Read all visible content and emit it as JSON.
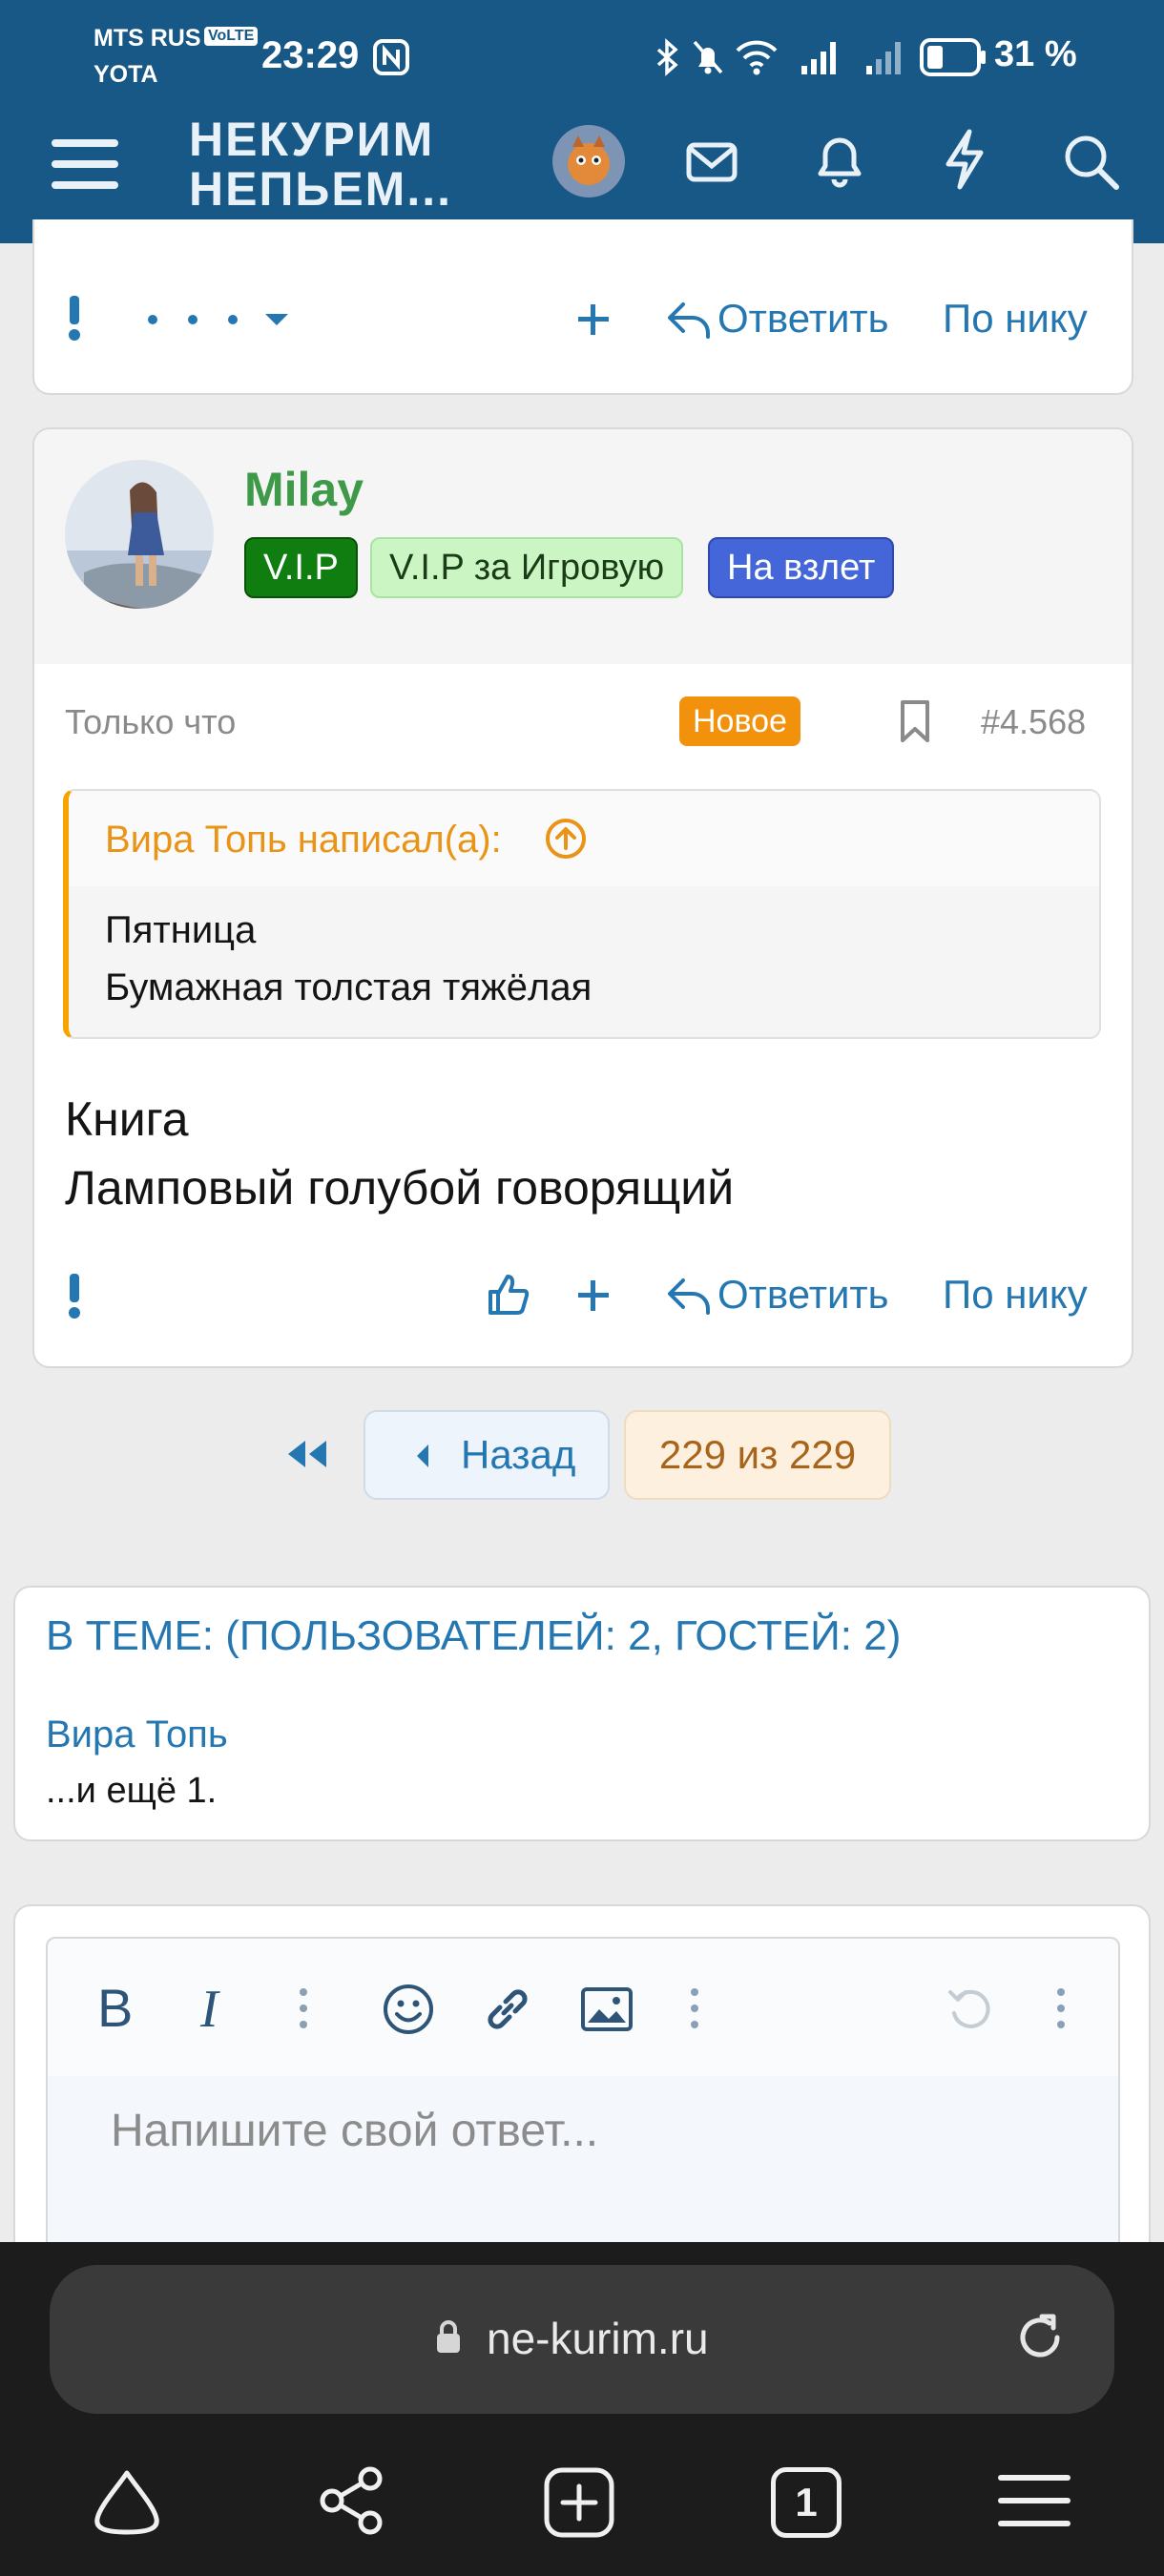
{
  "status_bar": {
    "carrier_1": "MTS RUS",
    "volte": "VoLTE",
    "carrier_2": "YOTA",
    "time": "23:29",
    "battery": "31 %"
  },
  "site_header": {
    "logo_line_1": "НЕКУРИМ",
    "logo_line_2": "НЕПЬЕМ..."
  },
  "prev_post_actions": {
    "reply": "Ответить",
    "by_nick": "По нику"
  },
  "post": {
    "username": "Milay",
    "badges": [
      "V.I.P",
      "V.I.P за Игровую",
      "На взлет"
    ],
    "time": "Только что",
    "new_label": "Новое",
    "number": "#4.568",
    "quote": {
      "author": "Вира Топь написал(а):",
      "line_1": "Пятница",
      "line_2": "Бумажная толстая тяжёлая"
    },
    "body_line_1": "Книга",
    "body_line_2": "Ламповый голубой говорящий",
    "reply": "Ответить",
    "by_nick": "По нику"
  },
  "pager": {
    "back": "Назад",
    "current": "229 из 229"
  },
  "online": {
    "title": "В ТЕМЕ: (ПОЛЬЗОВАТЕЛЕЙ: 2, ГОСТЕЙ: 2)",
    "user": "Вира Топь",
    "more": "...и ещё 1."
  },
  "editor": {
    "placeholder": "Напишите свой ответ..."
  },
  "browser": {
    "url": "ne-kurim.ru",
    "tab_count": "1"
  },
  "colors": {
    "header": "#185886",
    "link": "#2577b1",
    "username": "#3e9a48",
    "quote_accent": "#f7a400"
  }
}
